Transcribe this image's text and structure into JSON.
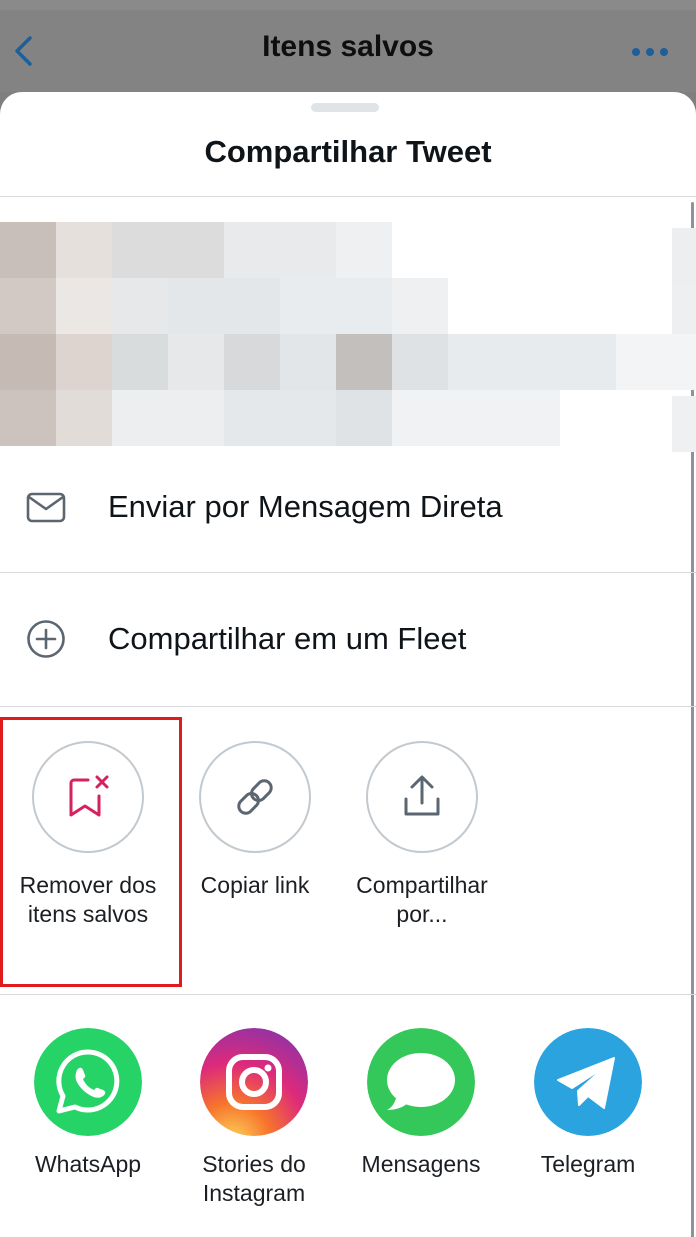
{
  "app_header": {
    "title": "Itens salvos"
  },
  "share_sheet": {
    "title": "Compartilhar Tweet",
    "rows": [
      {
        "label": "Enviar por Mensagem Direta",
        "icon": "mail-icon"
      },
      {
        "label": "Compartilhar em um Fleet",
        "icon": "plus-circle-icon"
      }
    ],
    "actions": [
      {
        "label": "Remover dos itens salvos",
        "icon": "bookmark-remove-icon",
        "highlighted": true
      },
      {
        "label": "Copiar link",
        "icon": "link-icon"
      },
      {
        "label": "Compartilhar por...",
        "icon": "share-upload-icon"
      }
    ],
    "apps": [
      {
        "label": "WhatsApp",
        "icon": "whatsapp-icon",
        "color": "#25d366"
      },
      {
        "label": "Stories do Instagram",
        "icon": "instagram-icon",
        "color": "#dd2a7b"
      },
      {
        "label": "Mensagens",
        "icon": "messages-icon",
        "color": "#34c759"
      },
      {
        "label": "Telegram",
        "icon": "telegram-icon",
        "color": "#2aa3df"
      }
    ]
  },
  "colors": {
    "accent": "#1d6fb8",
    "highlight": "#e01b1b",
    "remove_icon": "#d3225c"
  }
}
